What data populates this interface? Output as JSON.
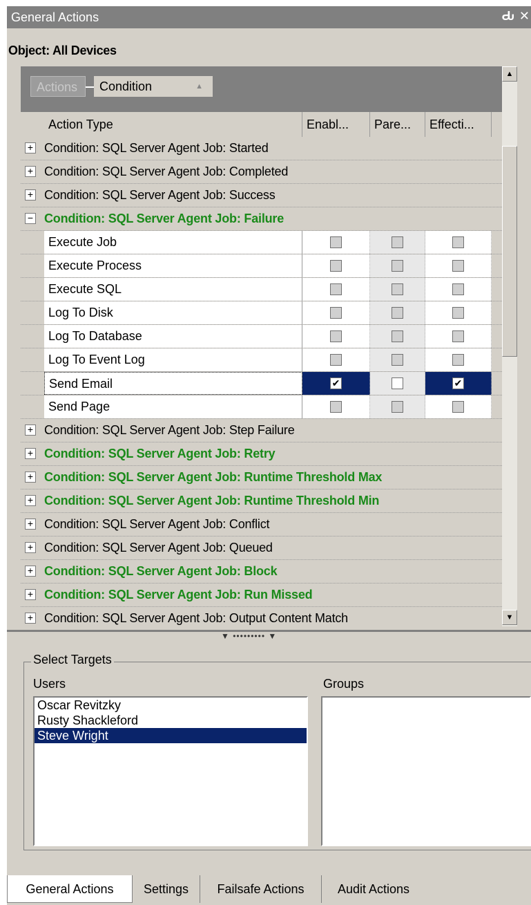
{
  "window": {
    "title": "General Actions",
    "pin_glyph": "Ԃ",
    "close_glyph": "✕"
  },
  "object_label": "Object: All Devices",
  "group_bar": {
    "chips": [
      "Actions",
      "Condition"
    ],
    "sort_glyph": "▲"
  },
  "columns": [
    "Action Type",
    "Enabl...",
    "Pare...",
    "Effecti..."
  ],
  "rows": [
    {
      "kind": "group",
      "expander": "+",
      "label": "Condition:  SQL Server Agent Job: Started",
      "green": false
    },
    {
      "kind": "group",
      "expander": "+",
      "label": "Condition:  SQL Server Agent Job: Completed",
      "green": false
    },
    {
      "kind": "group",
      "expander": "+",
      "label": "Condition:  SQL Server Agent Job: Success",
      "green": false
    },
    {
      "kind": "group",
      "expander": "−",
      "label": "Condition: SQL Server Agent Job: Failure",
      "green": true
    },
    {
      "kind": "child",
      "label": "Execute Job",
      "checks": [
        false,
        false,
        false
      ],
      "selected": false
    },
    {
      "kind": "child",
      "label": "Execute Process",
      "checks": [
        false,
        false,
        false
      ],
      "selected": false
    },
    {
      "kind": "child",
      "label": "Execute SQL",
      "checks": [
        false,
        false,
        false
      ],
      "selected": false
    },
    {
      "kind": "child",
      "label": "Log To Disk",
      "checks": [
        false,
        false,
        false
      ],
      "selected": false
    },
    {
      "kind": "child",
      "label": "Log To Database",
      "checks": [
        false,
        false,
        false
      ],
      "selected": false
    },
    {
      "kind": "child",
      "label": "Log To Event Log",
      "checks": [
        false,
        false,
        false
      ],
      "selected": false
    },
    {
      "kind": "child",
      "label": "Send Email",
      "checks": [
        true,
        false,
        true
      ],
      "selected": true
    },
    {
      "kind": "child",
      "label": "Send Page",
      "checks": [
        false,
        false,
        false
      ],
      "selected": false
    },
    {
      "kind": "group",
      "expander": "+",
      "label": "Condition:  SQL Server Agent Job: Step Failure",
      "green": false
    },
    {
      "kind": "group",
      "expander": "+",
      "label": "Condition: SQL Server Agent Job: Retry",
      "green": true
    },
    {
      "kind": "group",
      "expander": "+",
      "label": "Condition: SQL Server Agent Job: Runtime Threshold Max",
      "green": true
    },
    {
      "kind": "group",
      "expander": "+",
      "label": "Condition: SQL Server Agent Job: Runtime Threshold Min",
      "green": true
    },
    {
      "kind": "group",
      "expander": "+",
      "label": "Condition:  SQL Server Agent Job: Conflict",
      "green": false
    },
    {
      "kind": "group",
      "expander": "+",
      "label": "Condition:  SQL Server Agent Job: Queued",
      "green": false
    },
    {
      "kind": "group",
      "expander": "+",
      "label": "Condition: SQL Server Agent Job: Block",
      "green": true
    },
    {
      "kind": "group",
      "expander": "+",
      "label": "Condition: SQL Server Agent Job: Run Missed",
      "green": true
    },
    {
      "kind": "group",
      "expander": "+",
      "label": "Condition:  SQL Server Agent Job: Output Content Match",
      "green": false
    }
  ],
  "check_glyph": "✔",
  "scrollbar": {
    "up_glyph": "▲",
    "down_glyph": "▼"
  },
  "splitter_grip": "▼ ••••••••• ▼",
  "targets": {
    "legend": "Select Targets",
    "users_label": "Users",
    "groups_label": "Groups",
    "users": [
      {
        "name": "Oscar Revitzky",
        "selected": false
      },
      {
        "name": "Rusty  Shackleford",
        "selected": false
      },
      {
        "name": "Steve Wright",
        "selected": true
      }
    ],
    "groups": []
  },
  "tabs": [
    {
      "label": "General Actions",
      "active": true
    },
    {
      "label": "Settings",
      "active": false
    },
    {
      "label": "Failsafe Actions",
      "active": false
    },
    {
      "label": "Audit Actions",
      "active": false
    }
  ],
  "colors": {
    "green_text": "#1a8a1a",
    "selection": "#0a246a",
    "panel": "#d4d0c8"
  }
}
